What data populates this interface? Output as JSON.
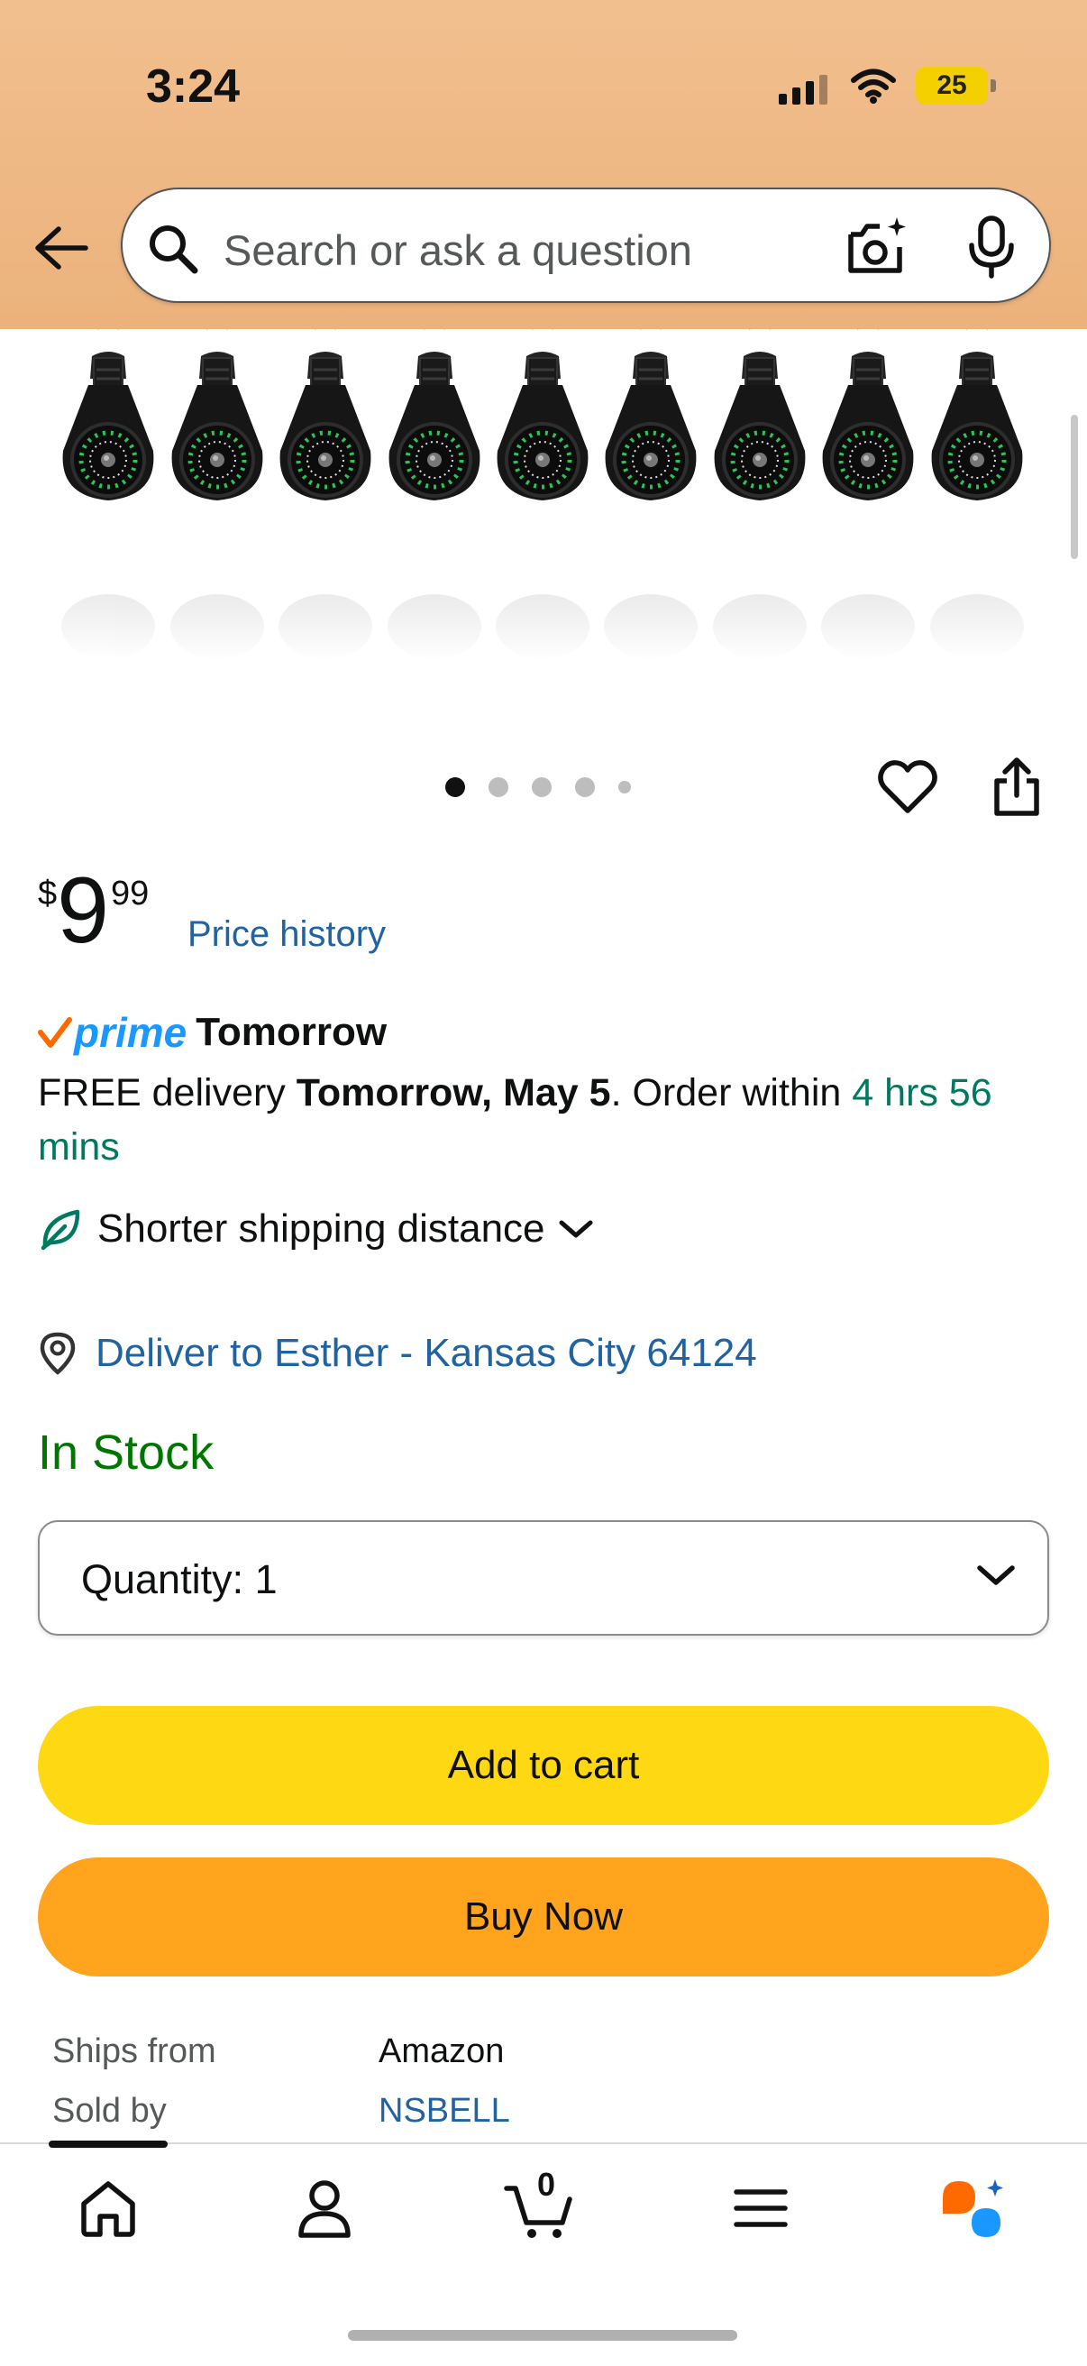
{
  "status_bar": {
    "time": "3:24",
    "battery": "25"
  },
  "search": {
    "placeholder": "Search or ask a question"
  },
  "gallery": {
    "image_count": 5,
    "active_index": 0
  },
  "price": {
    "symbol": "$",
    "whole": "9",
    "fraction": "99",
    "history_link": "Price history"
  },
  "delivery": {
    "prime_label": "prime",
    "prime_day": "Tomorrow",
    "prefix": "FREE delivery ",
    "date": "Tomorrow, May 5",
    "order_within": ". Order within ",
    "countdown": "4 hrs 56 mins",
    "shipping_note": "Shorter shipping distance",
    "deliver_to": "Deliver to Esther - Kansas City 64124"
  },
  "stock": {
    "status": "In Stock"
  },
  "quantity": {
    "label": "Quantity:",
    "value": "1"
  },
  "buttons": {
    "add_to_cart": "Add to cart",
    "buy_now": "Buy Now"
  },
  "seller": {
    "ships_from_label": "Ships from",
    "ships_from_value": "Amazon",
    "sold_by_label": "Sold by",
    "sold_by_value": "NSBELL"
  },
  "tabbar": {
    "cart_count": "0"
  },
  "colors": {
    "header_bg": "#ecb27c",
    "link": "#2162a1",
    "in_stock": "#007600",
    "countdown": "#007a5e",
    "add_to_cart": "#ffd814",
    "buy_now": "#ffa41c",
    "prime_blue": "#1a98ff"
  },
  "icons": [
    "back-arrow-icon",
    "search-icon",
    "camera-icon",
    "mic-icon",
    "heart-icon",
    "share-icon",
    "leaf-icon",
    "location-pin-icon",
    "chevron-down-icon",
    "home-icon",
    "account-icon",
    "cart-icon",
    "menu-icon",
    "rufus-icon"
  ]
}
